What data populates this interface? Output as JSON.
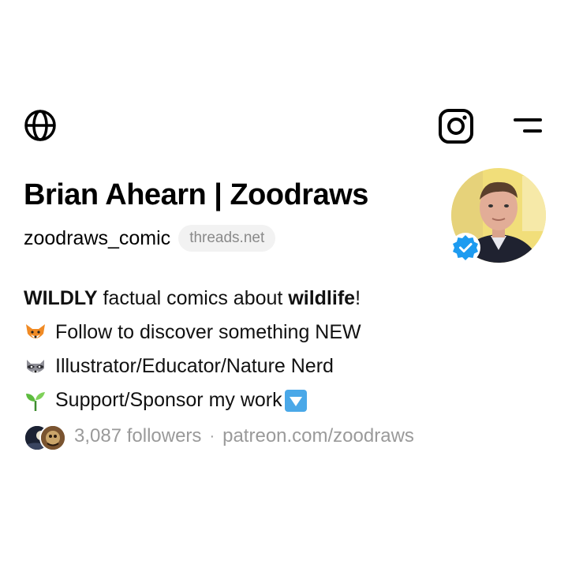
{
  "header": {
    "globe_icon": "globe-icon",
    "instagram_icon": "instagram-icon",
    "menu_icon": "menu-icon"
  },
  "profile": {
    "display_name": "Brian Ahearn | Zoodraws",
    "handle": "zoodraws_comic",
    "threads_chip": "threads.net",
    "verified": true,
    "accent_color": "#1d9bf0"
  },
  "bio": {
    "line1": {
      "bold1": "WILDLY",
      "text1": " factual comics about ",
      "bold2": "wildlife",
      "text2": "!"
    },
    "line2": {
      "emoji": "fox-emoji",
      "text": "Follow to discover something NEW"
    },
    "line3": {
      "emoji": "raccoon-emoji",
      "text": "Illustrator/Educator/Nature Nerd"
    },
    "line4": {
      "emoji": "seedling-emoji",
      "text": "Support/Sponsor my work",
      "emoji_after": "down-arrow-button-emoji"
    }
  },
  "footer": {
    "followers": "3,087 followers",
    "separator": "·",
    "link": "patreon.com/zoodraws"
  }
}
